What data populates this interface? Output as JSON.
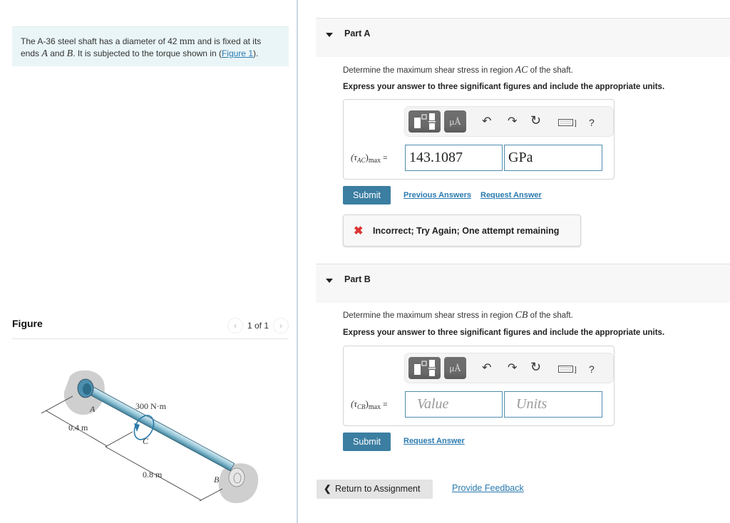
{
  "problem": {
    "text_1": "The A-36 steel shaft has a diameter of 42 ",
    "unit_mm": "mm",
    "text_2": " and is fixed at its ends ",
    "var_A": "A",
    "text_3": " and ",
    "var_B": "B",
    "text_4": ". It is subjected to the torque shown in (",
    "figure_link": "Figure 1",
    "text_5": ")."
  },
  "figure": {
    "title": "Figure",
    "pager": "1 of 1",
    "prev_icon": "‹",
    "next_icon": "›",
    "labels": {
      "A": "A",
      "B": "B",
      "C": "C",
      "torque": "300 N·m",
      "dim_AC": "0.4 m",
      "dim_CB": "0.8 m"
    }
  },
  "parts": [
    {
      "label": "Part A",
      "question_1": "Determine the maximum shear stress in region ",
      "region": "AC",
      "question_2": " of the shaft.",
      "instruction": "Express your answer to three significant figures and include the appropriate units.",
      "toolbar": {
        "units_label": "μÅ",
        "undo": "↶",
        "redo": "↷",
        "reset": "↻",
        "keyboard": "⌨]",
        "help": "?"
      },
      "eq_tau": "(τ",
      "eq_sub": "AC",
      "eq_close": ")",
      "eq_max": "max",
      "eq_equals": " =",
      "value": "143.1087",
      "units": "GPa",
      "submit": "Submit",
      "previous_answers": "Previous Answers",
      "request_answer": "Request Answer",
      "feedback_icon": "✖",
      "feedback": "Incorrect; Try Again; One attempt remaining"
    },
    {
      "label": "Part B",
      "question_1": "Determine the maximum shear stress in region ",
      "region": "CB",
      "question_2": " of the shaft.",
      "instruction": "Express your answer to three significant figures and include the appropriate units.",
      "toolbar": {
        "units_label": "μÅ",
        "undo": "↶",
        "redo": "↷",
        "reset": "↻",
        "keyboard": "⌨]",
        "help": "?"
      },
      "eq_tau": "(τ",
      "eq_sub": "CB",
      "eq_close": ")",
      "eq_max": "max",
      "eq_equals": " =",
      "value_placeholder": "Value",
      "units_placeholder": "Units",
      "submit": "Submit",
      "request_answer": "Request Answer"
    }
  ],
  "footer": {
    "return_icon": "❮",
    "return_label": "Return to Assignment",
    "provide_feedback": "Provide Feedback"
  }
}
